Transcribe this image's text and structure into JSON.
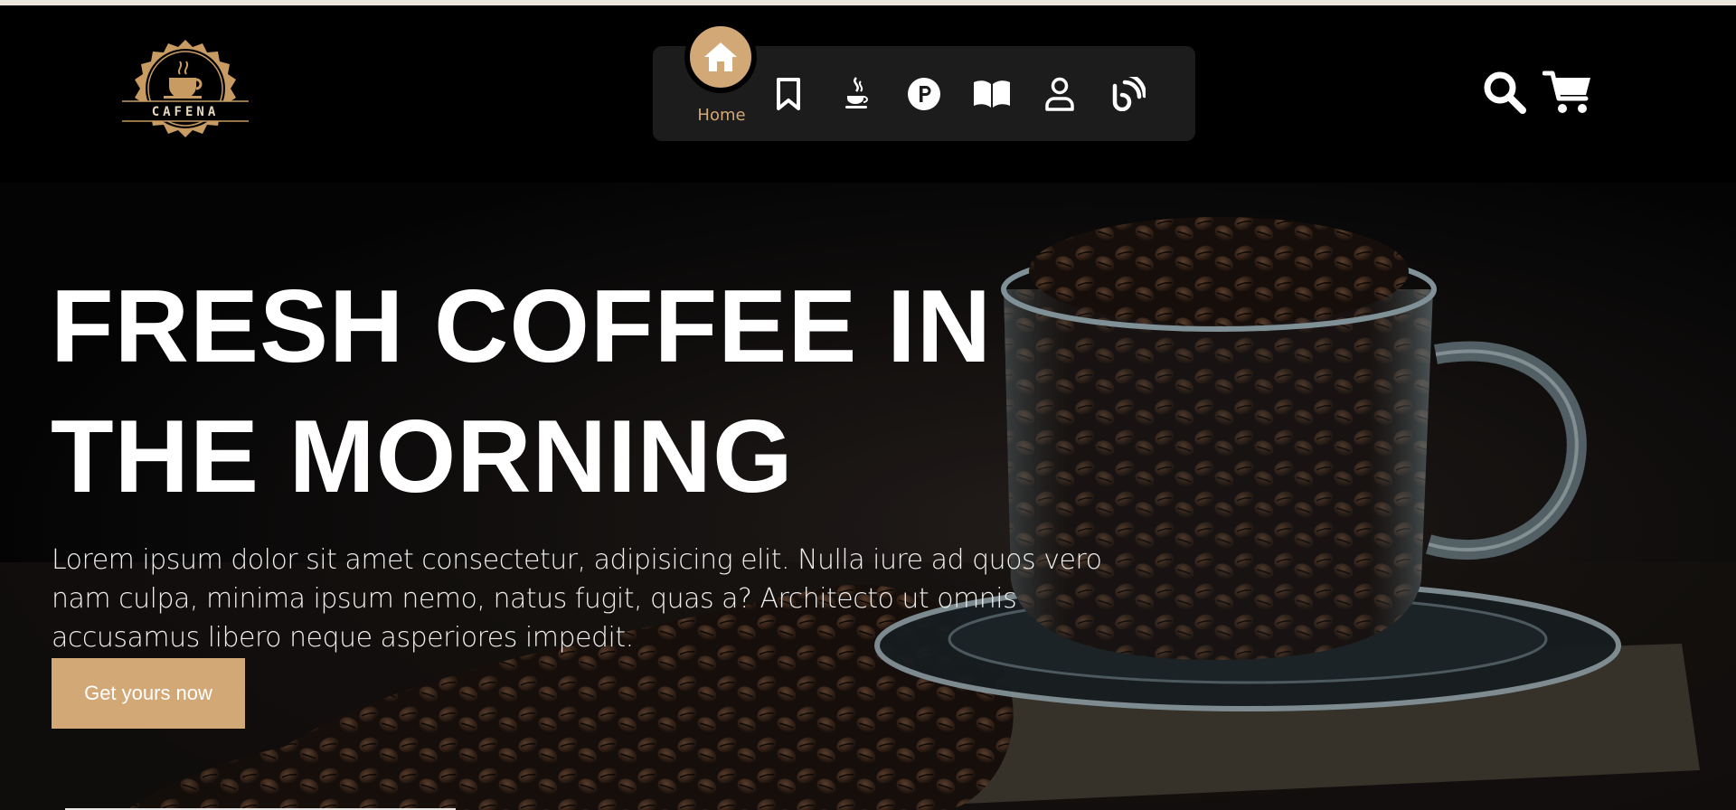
{
  "brand": {
    "logo_text": "CAFENA",
    "accent_color": "#d2a877"
  },
  "nav": {
    "items": [
      {
        "label": "Home",
        "icon": "home-icon",
        "active": true
      },
      {
        "label": "",
        "icon": "bookmark-icon"
      },
      {
        "label": "",
        "icon": "java-cup-icon"
      },
      {
        "label": "",
        "icon": "product-hunt-icon"
      },
      {
        "label": "",
        "icon": "book-open-icon"
      },
      {
        "label": "",
        "icon": "user-icon"
      },
      {
        "label": "",
        "icon": "blog-icon"
      }
    ]
  },
  "header_actions": [
    {
      "icon": "search-icon"
    },
    {
      "icon": "cart-icon"
    }
  ],
  "hero": {
    "title_line1": "FRESH COFFEE IN",
    "title_line2": "THE MORNING",
    "description": "Lorem ipsum dolor sit amet consectetur, adipisicing elit. Nulla iure ad quos vero nam culpa, minima ipsum nemo, natus fugit, quas a? Architecto ut omnis accusamus libero neque asperiores impedit.",
    "cta_label": "Get yours now"
  }
}
